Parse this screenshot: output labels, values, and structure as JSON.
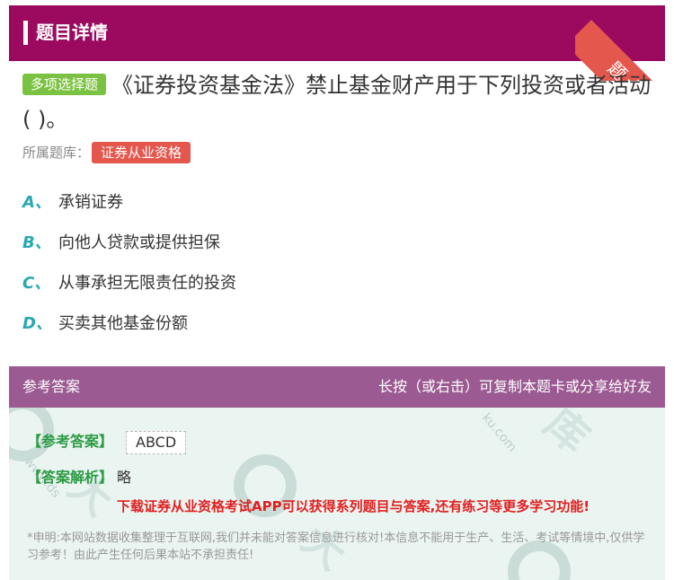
{
  "header": {
    "title": "题目详情",
    "corner_badge": "题卡"
  },
  "question": {
    "type_tag": "多项选择题",
    "text": "《证券投资基金法》禁止基金财产用于下列投资或者活动( )。",
    "bank_label": "所属题库：",
    "bank_name": "证券从业资格"
  },
  "options": [
    {
      "letter": "A、",
      "text": "承销证券"
    },
    {
      "letter": "B、",
      "text": "向他人贷款或提供担保"
    },
    {
      "letter": "C、",
      "text": "从事承担无限责任的投资"
    },
    {
      "letter": "D、",
      "text": "买卖其他基金份额"
    }
  ],
  "answer_section": {
    "title": "参考答案",
    "hint": "长按（或右击）可复制本题卡或分享给好友",
    "answer_label": "【参考答案】",
    "answer_value": "ABCD",
    "analysis_label": "【答案解析】",
    "analysis_value": "略",
    "promo": "下载证券从业资格考试APP可以获得系列题目与答案,还有练习等更多学习功能!",
    "disclaimer": "*申明:本网站数据收集整理于互联网,我们并未能对答案信息进行核对!本信息不能用于生产、生活、考试等情境中,仅供学习参考！由此产生任何后果本站不承担责任!"
  },
  "colors": {
    "header_bg": "#9b0a5e",
    "answer_head_bg": "#9b5a92",
    "type_tag_bg": "#7cc242",
    "bank_tag_bg": "#e4574d",
    "option_letter": "#2aa7b0",
    "answer_label": "#2c9b44",
    "promo_text": "#e02020"
  }
}
